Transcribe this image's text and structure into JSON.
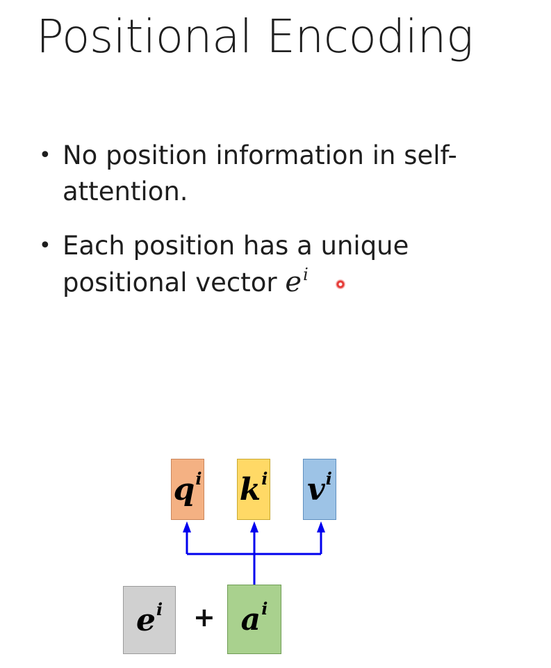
{
  "slide": {
    "title": "Positional Encoding",
    "bullets": [
      {
        "text": "No position information in self-attention."
      },
      {
        "text": "Each position has a unique positional vector ",
        "math_symbol": "e",
        "math_superscript": "i"
      }
    ]
  },
  "diagram": {
    "outputs": [
      {
        "symbol": "q",
        "superscript": "i",
        "color": "#f4b183"
      },
      {
        "symbol": "k",
        "superscript": "i",
        "color": "#ffd966"
      },
      {
        "symbol": "v",
        "superscript": "i",
        "color": "#9dc3e6"
      }
    ],
    "inputs": [
      {
        "symbol": "e",
        "superscript": "i",
        "color": "#d0d0d0"
      },
      {
        "symbol": "a",
        "superscript": "i",
        "color": "#a9d18e"
      }
    ],
    "operator": "+",
    "arrow_color": "#0000ee"
  }
}
